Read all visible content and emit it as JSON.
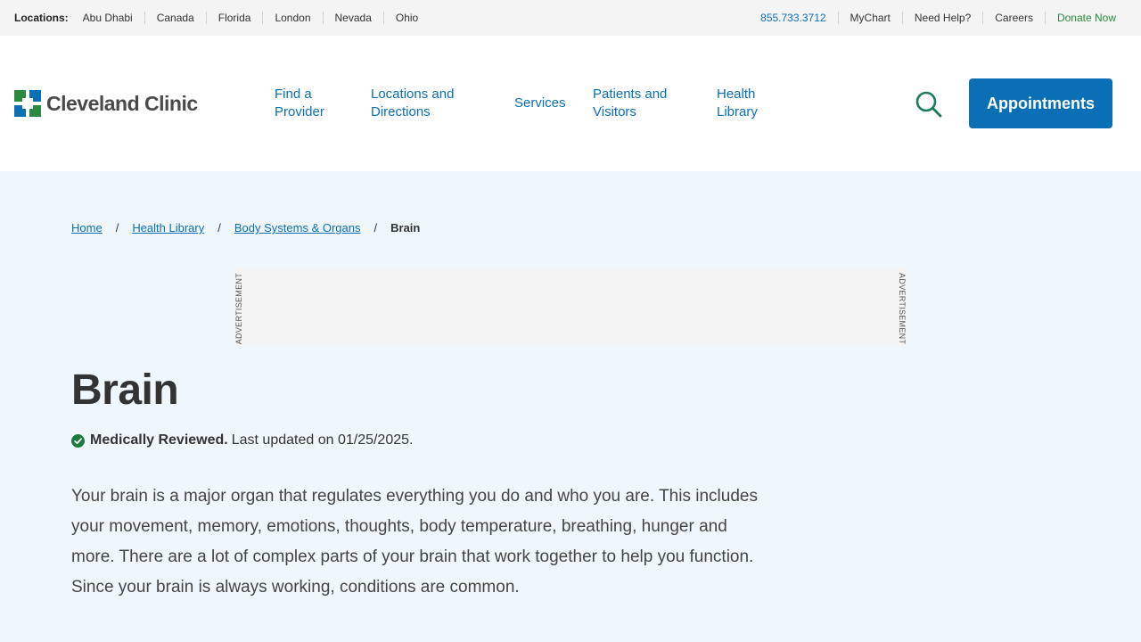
{
  "utility": {
    "locations_label": "Locations:",
    "locations": [
      "Abu Dhabi",
      "Canada",
      "Florida",
      "London",
      "Nevada",
      "Ohio"
    ],
    "phone": "855.733.3712",
    "mychart": "MyChart",
    "help": "Need Help?",
    "careers": "Careers",
    "donate": "Donate Now"
  },
  "header": {
    "logo_text": "Cleveland Clinic",
    "nav": {
      "find_provider": [
        "Find a",
        "Provider"
      ],
      "locations": [
        "Locations and",
        "Directions"
      ],
      "services": [
        "Services"
      ],
      "patients": [
        "Patients and",
        "Visitors"
      ],
      "health_library": [
        "Health",
        "Library"
      ]
    },
    "appointments": "Appointments"
  },
  "breadcrumb": {
    "home": "Home",
    "health_library": "Health Library",
    "body_systems": "Body Systems & Organs",
    "current": "Brain",
    "separator": "/"
  },
  "ad": {
    "label": "ADVERTISEMENT"
  },
  "article": {
    "title": "Brain",
    "reviewed_label": "Medically Reviewed.",
    "last_updated": "Last updated on 01/25/2025.",
    "lede": "Your brain is a major organ that regulates everything you do and who you are. This includes your movement, memory, emotions, thoughts, body temperature, breathing, hunger and more. There are a lot of complex parts of your brain that work together to help you function. Since your brain is always working, conditions are common."
  },
  "colors": {
    "brand_blue": "#0a6fb5",
    "brand_green": "#2a8a3e",
    "page_bg": "#eff7fc"
  }
}
